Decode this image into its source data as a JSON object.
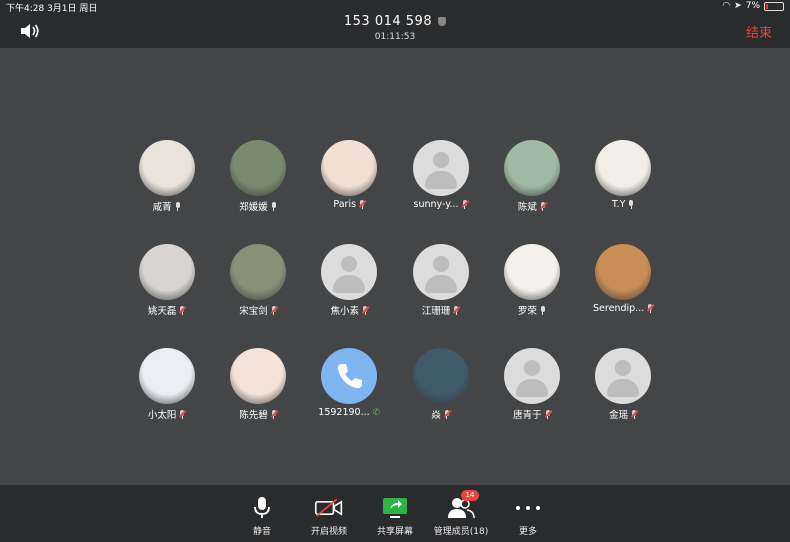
{
  "status_bar": {
    "time_date": "下午4:28  3月1日 周日",
    "battery_percent": "7%"
  },
  "header": {
    "meeting_id": "153 014 598",
    "timer": "01:11:53",
    "end_label": "结束"
  },
  "participants": [
    [
      {
        "name": "咸菁",
        "mic": "on",
        "avatar": "photo",
        "color": "#e9e3dc"
      },
      {
        "name": "郑媛媛",
        "mic": "on",
        "avatar": "photo",
        "color": "#7a8a6e"
      },
      {
        "name": "Paris",
        "mic": "muted",
        "avatar": "photo",
        "color": "#f1dfd4"
      },
      {
        "name": "sunny-y...",
        "mic": "muted",
        "avatar": "default",
        "color": "#e6e6e6"
      },
      {
        "name": "陈斌",
        "mic": "muted",
        "avatar": "photo",
        "color": "#9fb9a2"
      },
      {
        "name": "T.Y",
        "mic": "on",
        "avatar": "photo",
        "color": "#f2efe8"
      }
    ],
    [
      {
        "name": "姚天磊",
        "mic": "muted",
        "avatar": "photo",
        "color": "#d8d5d0"
      },
      {
        "name": "宋宝剑",
        "mic": "muted",
        "avatar": "photo",
        "color": "#8a8f7a"
      },
      {
        "name": "焦小素",
        "mic": "muted",
        "avatar": "default",
        "color": "#dcdcdc"
      },
      {
        "name": "江珊珊",
        "mic": "muted",
        "avatar": "default",
        "color": "#dcdcdc"
      },
      {
        "name": "罗荣",
        "mic": "on",
        "avatar": "photo",
        "color": "#f4f1ea"
      },
      {
        "name": "Serendip...",
        "mic": "muted",
        "avatar": "photo",
        "color": "#c98d55"
      }
    ],
    [
      {
        "name": "小太阳",
        "mic": "muted",
        "avatar": "photo",
        "color": "#e8eef2"
      },
      {
        "name": "陈先碧",
        "mic": "muted",
        "avatar": "photo",
        "color": "#f3e3d9"
      },
      {
        "name": "1592190...",
        "mic": "phone",
        "avatar": "phone",
        "color": "#7fb6f2"
      },
      {
        "name": "焱",
        "mic": "muted",
        "avatar": "photo",
        "color": "#3f5a68"
      },
      {
        "name": "唐青于",
        "mic": "muted",
        "avatar": "default",
        "color": "#dcdcdc"
      },
      {
        "name": "金瑶",
        "mic": "muted",
        "avatar": "default",
        "color": "#dcdcdc"
      }
    ]
  ],
  "toolbar": {
    "mute_label": "静音",
    "video_label": "开启视频",
    "share_label": "共享屏幕",
    "members_label": "管理成员(18)",
    "members_badge": "14",
    "more_label": "更多"
  },
  "colors": {
    "background": "#434547",
    "bar": "#2a2b2d",
    "end": "#e8453c",
    "share": "#2fb344"
  }
}
